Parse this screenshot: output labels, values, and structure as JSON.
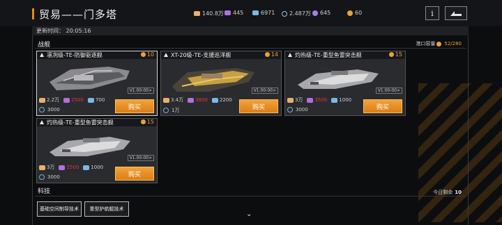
{
  "header": {
    "title": "贸易——门多塔",
    "resources": [
      {
        "icon": "credits-icon",
        "value": "140.8万",
        "color": "#e8b070"
      },
      {
        "icon": "crystal-icon",
        "value": "445",
        "color": "#b070e0"
      },
      {
        "icon": "metal-icon",
        "value": "6971",
        "color": "#7ab8e8"
      },
      {
        "icon": "energy-icon",
        "value": "2.487万",
        "color": "#90c8e8"
      },
      {
        "icon": "gem-icon",
        "value": "645",
        "color": "#a080f0"
      },
      {
        "icon": "gold-coin-icon",
        "value": "60",
        "color": "#e8a23a"
      }
    ],
    "info_label": "i"
  },
  "update_time": "更新时间： 20:05:16",
  "ships_section": {
    "title": "战舰",
    "port_capacity_label": "港口容量",
    "port_capacity_value": "52/280"
  },
  "ships": [
    {
      "name": "凛冽级-TE-防御驱逐舰",
      "level": "10",
      "version": "V1.00-00>",
      "price_a": "2.2万",
      "price_b": "2500",
      "price_c": "700",
      "time": "3000",
      "buy": "购买",
      "b_insufficient": true,
      "ship_color": "#9a9a9a"
    },
    {
      "name": "XT-20级-TE-支援巡洋舰",
      "level": "14",
      "version": "V1.00-00>",
      "price_a": "3.4万",
      "price_b": "3800",
      "price_c": "2200",
      "time": "1万",
      "buy": "购买",
      "b_insufficient": true,
      "ship_color": "#c8a040"
    },
    {
      "name": "灼热级-TE-重型鱼雷突击舰",
      "level": "15",
      "version": "V1.00-00>",
      "price_a": "3万",
      "price_b": "3500",
      "price_c": "1000",
      "time": "3000",
      "buy": "购买",
      "b_insufficient": true,
      "ship_color": "#bcbcbc"
    },
    {
      "name": "灼热级-TE-重型鱼雷突击舰",
      "level": "15",
      "version": "V1.00-00>",
      "price_a": "3万",
      "price_b": "2500",
      "price_c": "1000",
      "time": "3000",
      "buy": "购买",
      "b_insufficient": true,
      "ship_color": "#bcbcbc"
    }
  ],
  "tech_section": {
    "title": "科技",
    "remaining_label": "今日剩余",
    "remaining_value": "10",
    "items": [
      "基础空间制导技术",
      "重型护航艇技术"
    ]
  }
}
